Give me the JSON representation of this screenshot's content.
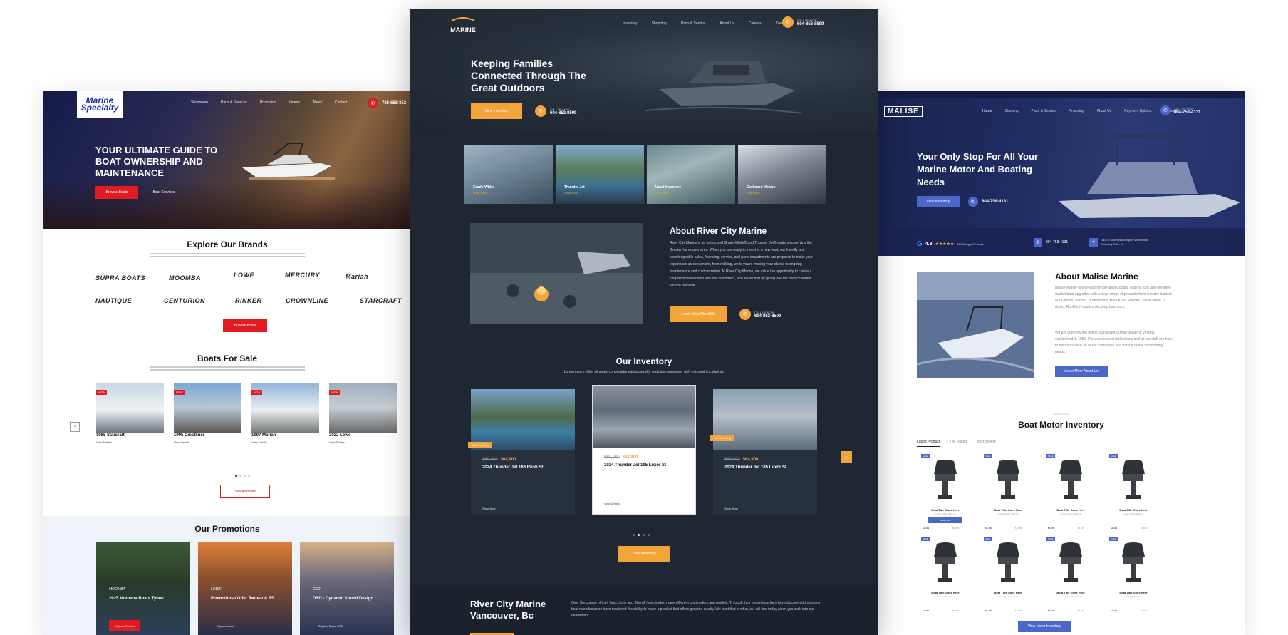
{
  "colors": {
    "left_accent": "#e11b22",
    "center_bg": "#1f2732",
    "center_accent": "#f3a53c",
    "right_hero": "#202d63",
    "right_accent": "#4a67c9"
  },
  "left": {
    "logo_text": "Marine Specialty",
    "nav": [
      "Showroom",
      "Parts & Services",
      "Promotion",
      "Videos",
      "About",
      "Contact"
    ],
    "phone": "785-658-352",
    "hero_title": "YOUR ULTIMATE GUIDE TO BOAT OWNERSHIP AND MAINTENANCE",
    "hero_btn_primary": "Browse Boats",
    "hero_btn_secondary": "Boat Services",
    "brands_title": "Explore Our Brands",
    "brands": [
      "SUPRA BOATS",
      "MOOMBA",
      "LOWE",
      "MERCURY",
      "Mariah",
      "NAUTIQUE",
      "CENTURION",
      "RINKER",
      "CROWNLINE",
      "STARCRAFT"
    ],
    "brands_btn": "Browse Boats",
    "boats_title": "Boats For Sale",
    "boats": [
      {
        "tag": "NEW",
        "name": "1985 Starcraft",
        "link": "View Details"
      },
      {
        "tag": "NEW",
        "name": "1995 Crestliner",
        "link": "View Details"
      },
      {
        "tag": "NEW",
        "name": "1997 Mariah",
        "link": "View Details"
      },
      {
        "tag": "NEW",
        "name": "2022 Lowe",
        "link": "View Details"
      }
    ],
    "boats_btn": "See All Boats",
    "promos_title": "Our Promotions",
    "promos": [
      {
        "logo": "MOOMBA",
        "title": "2025 Moomba Boats Tyhee",
        "btn": "Explore Promos"
      },
      {
        "logo": "LOWE",
        "title": "Promotional Offer Retreat & FS",
        "btn": "Explore Lowe"
      },
      {
        "logo": "DSD",
        "title": "DSD - Dynamic Sound Design",
        "btn": "Explore Supra DSD"
      }
    ]
  },
  "center": {
    "logo_text": "MARINE",
    "nav": [
      "Inventory",
      "Shopping",
      "Parts & Service",
      "About Us",
      "Careers",
      "Contact"
    ],
    "phone_label": "CALL US NOW",
    "phone": "604-852-8599",
    "hero_title": "Keeping Families Connected Through The Great Outdoors",
    "hero_btn": "View Inventory",
    "tiles": [
      {
        "name": "Grady-White",
        "link": "Shop Now"
      },
      {
        "name": "Thunder Jet",
        "link": "Shop Now"
      },
      {
        "name": "Used Inventory",
        "link": "Shop Now"
      },
      {
        "name": "Outboard Motors",
        "link": "Shop Now"
      }
    ],
    "about_title": "About River City Marine",
    "about_text": "River City Marine is an authorized Grady-White® and Thunder Jet® dealership serving the Greater Vancouver area. When you are ready to invest in a new boat, our friendly and knowledgeable sales, financing, service, and parts departments are prepared to make your experience as convenient, from walking, while you're making your choice to ongoing maintenance and customization. At River City Marine, we value the opportunity to create a long-term relationship with our customers, and we do that by giving you the best customer service possible.",
    "about_btn": "Learn More About Us",
    "inventory_title": "Our Inventory",
    "inventory_sub": "Lorem ipsum dolor sit amet, consectetur adipiscing elit, sed diam nonummy nibh euismod tincidunt ut.",
    "inventory": [
      {
        "badge": "Sale Pending",
        "old": "$69,900",
        "price": "$64,900",
        "name": "2024 Thunder Jet 186 Rush St",
        "link": "Shop Now"
      },
      {
        "badge": "",
        "old": "$69,900",
        "price": "$64,900",
        "name": "2024 Thunder Jet 195 Luxor St",
        "link": "View Details"
      },
      {
        "badge": "Sale Pending",
        "old": "$69,900",
        "price": "$64,900",
        "name": "2024 Thunder Jet 185 Luxor St",
        "link": "Shop Now"
      }
    ],
    "inventory_btn": "View Inventory",
    "band_title": "River City Marine Vancouver, Bc",
    "band_text": "Over the course of their lives, John and Sherrill have traded many different boat makes and models. Through their experience they have discovered that some boat manufacturers have mastered the ability to make a product that offers genuine quality. We trust that is what you will find today when you walk into our dealership."
  },
  "right": {
    "logo_text": "MALISE",
    "nav": [
      "Home",
      "Showing",
      "Parts & Service",
      "Financing",
      "About Us",
      "Payment Options",
      "Contact"
    ],
    "phone_label": "CALL US NOW",
    "phone": "804-758-4131",
    "hero_title": "Your Only Stop For All Your Marine Motor And Boating Needs",
    "hero_btn": "View Inventory",
    "hero_phone": "804-758-4131",
    "rating_value": "4.8",
    "rating_stars": "★★★★★",
    "rating_reviews": "121 Google Reviews",
    "info_phone": "804-758-4131",
    "info_address": "14576 South Washington Mechanics Parkway Suite 11",
    "about_title": "About Malise Marine",
    "about_text_1": "Malise Marine is one-stop for top-quality boats, experts jobs and our after-market boat upgrades with a large range of products from industry leaders like Garmin, Simrad, Humminbird, Minn Kota, Rhodes, Taylor audio, JL Audio, Rockford, custom decking, Lowrance.",
    "about_text_2": "We are currently the oldest authorized Suzuki dealer in Virginia, established in 1982. Our experienced technicians and all our staff are here to help and serve all of our customers and marine motor and boating needs.",
    "about_btn": "Learn More About Us",
    "inv_eyebrow": "SHOP NOW",
    "inv_title": "Boat Motor Inventory",
    "tabs": [
      "Latest Product",
      "Top Rating",
      "Best Sellers"
    ],
    "motor_title": "Boat Title Goes Here",
    "motor_sub": "Lorem ipsum dolor sit",
    "motor_price": "$2,499",
    "motor_old": "$2,699",
    "motor_tag": "SALE",
    "motor_btn": "Shop Now",
    "motor_btn_bottom": "View Motor Inventory"
  }
}
